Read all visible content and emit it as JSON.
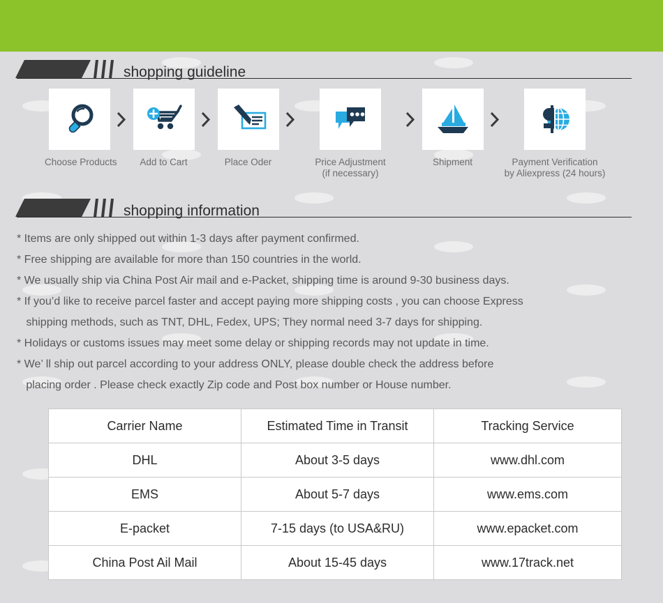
{
  "theme": {
    "green": "#8cc22a",
    "background": "#dcdcde",
    "banner_dark": "#3b3b3b",
    "icon_dark": "#1e3a52",
    "icon_blue": "#29abe2"
  },
  "guideline": {
    "title": "shopping guideline",
    "steps": [
      {
        "icon": "magnifier-icon",
        "label_line1": "Choose Products",
        "label_line2": ""
      },
      {
        "icon": "add-to-cart-icon",
        "label_line1": "Add to Cart",
        "label_line2": ""
      },
      {
        "icon": "pen-cheque-icon",
        "label_line1": "Place Oder",
        "label_line2": ""
      },
      {
        "icon": "chat-bubbles-icon",
        "label_line1": "Price Adjustment",
        "label_line2": "(if necessary)"
      },
      {
        "icon": "sailboat-icon",
        "label_line1": "Shipment",
        "label_line2": ""
      },
      {
        "icon": "dollar-globe-icon",
        "label_line1": "Payment Verification",
        "label_line2": "by  Aliexpress (24 hours)"
      }
    ],
    "separator": "chevron-right-icon"
  },
  "information": {
    "title": "shopping information",
    "lines": [
      "* Items are only shipped out within 1-3 days after payment confirmed.",
      "* Free shipping are available for more than 150 countries in the world.",
      "* We usually ship via China Post Air mail and e-Packet, shipping time is around 9-30 business days.",
      "* If you’d like to receive parcel faster and accept paying more shipping costs , you can choose Express",
      "   shipping methods, such as TNT, DHL, Fedex, UPS; They normal need 3-7 days for shipping.",
      "* Holidays or customs issues may meet some delay or shipping records may not update in time.",
      "* We’ ll ship out parcel according to your address ONLY, please double check the address before",
      "   placing order . Please check exactly Zip code and Post box number or House number."
    ]
  },
  "carrier_table": {
    "headers": [
      "Carrier Name",
      "Estimated Time in Transit",
      "Tracking Service"
    ],
    "rows": [
      [
        "DHL",
        "About 3-5 days",
        "www.dhl.com"
      ],
      [
        "EMS",
        "About 5-7 days",
        "www.ems.com"
      ],
      [
        "E-packet",
        "7-15 days (to USA&RU)",
        "www.epacket.com"
      ],
      [
        "China Post Ail Mail",
        "About 15-45 days",
        "www.17track.net"
      ]
    ]
  }
}
